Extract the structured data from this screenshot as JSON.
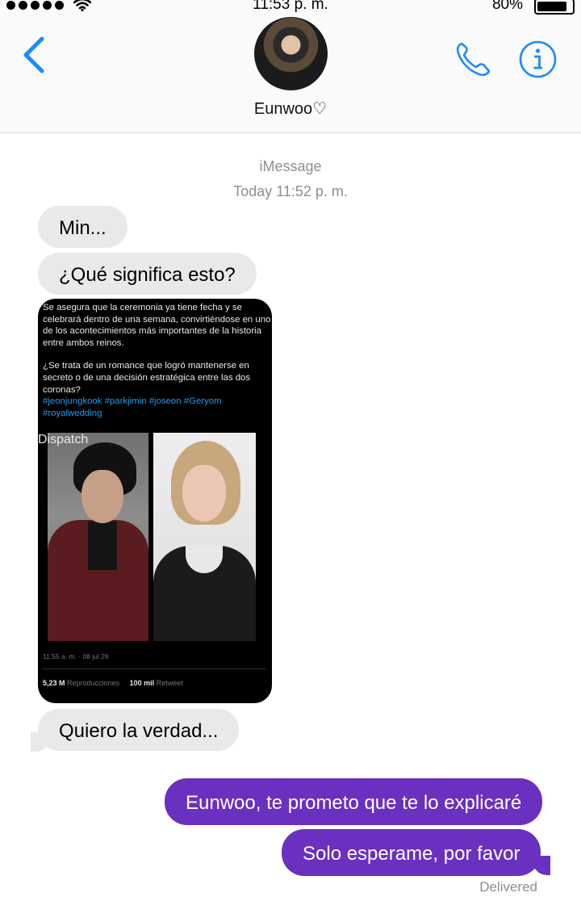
{
  "status_bar": {
    "time": "11:53 p. m.",
    "battery_text": "80%",
    "battery_level": 0.8
  },
  "header": {
    "contact_name": "Eunwoo♡"
  },
  "conversation_meta": {
    "service": "iMessage",
    "timestamp": "Today 11:52 p. m."
  },
  "messages": [
    {
      "direction": "incoming",
      "text": "Min..."
    },
    {
      "direction": "incoming",
      "text": "¿Qué significa esto?"
    },
    {
      "direction": "incoming",
      "text": "Quiero la verdad..."
    },
    {
      "direction": "outgoing",
      "text": "Eunwoo, te prometo que te lo explicaré"
    },
    {
      "direction": "outgoing",
      "text": "Solo esperame, por favor"
    }
  ],
  "tweet": {
    "paragraph1": "Se asegura que la ceremonia ya tiene fecha y se celebrará dentro de una semana, convirtiéndose en uno de los acontecimientos más importantes de la historia entre ambos reinos.",
    "paragraph2": "¿Se trata de un romance que logró mantenerse en secreto o de una decisión estratégica entre las dos coronas?",
    "hashtags": "#jeonjungkook #parkjimin #joseon #Geryom #royalwedding",
    "watermark": "Dispatch",
    "timestamp": "11:55 a. m. · 08 jul 26",
    "views_value": "5,23 M",
    "views_label": "Reproducciones",
    "retweets_value": "100 mil",
    "retweets_label": "Retweet"
  },
  "delivery_status": "Delivered",
  "colors": {
    "accent_blue": "#1a8cff",
    "outgoing_bubble": "#6a30c0",
    "incoming_bubble": "#e9e9eb",
    "meta_gray": "#8e8e93",
    "hashtag_blue": "#1d9bf0"
  },
  "icons": [
    "chevron-left-icon",
    "phone-icon",
    "info-icon",
    "wifi-icon",
    "battery-icon"
  ]
}
